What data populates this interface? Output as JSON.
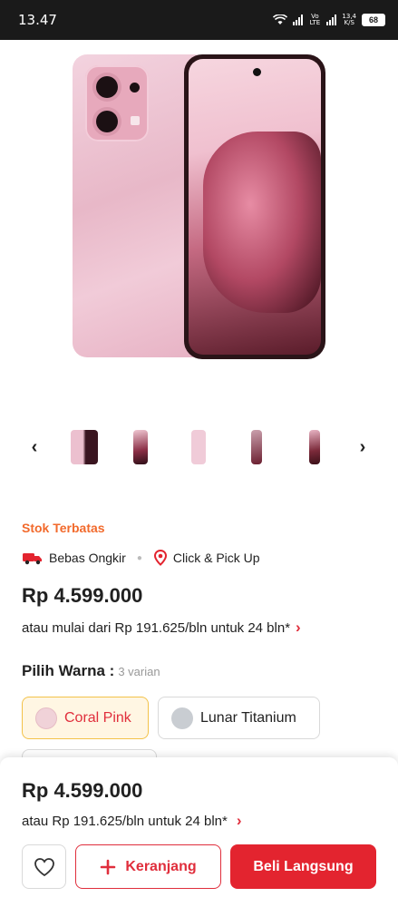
{
  "status_bar": {
    "time": "13.47",
    "network_label": "Vo LTE",
    "speed_value": "13,4",
    "speed_unit": "K/S",
    "battery": "68"
  },
  "product": {
    "stock_label": "Stok Terbatas",
    "shipping": {
      "free_shipping": "Bebas Ongkir",
      "pickup": "Click & Pick Up"
    },
    "price": "Rp 4.599.000",
    "installment": "atau mulai dari Rp 191.625/bln untuk 24 bln*",
    "color_selector": {
      "label": "Pilih Warna :",
      "variant_count": "3 varian",
      "options": [
        {
          "name": "Coral Pink",
          "swatch": "#f0d2d8",
          "selected": true
        },
        {
          "name": "Lunar Titanium",
          "swatch": "#c9cdd2",
          "selected": false
        }
      ]
    }
  },
  "thumbnails": [
    {
      "icon": "phone-thumbnail",
      "color": "#e8b4c4"
    },
    {
      "icon": "phone-thumbnail",
      "color": "#7b2a3a"
    },
    {
      "icon": "phone-thumbnail",
      "color": "#f1d0dc"
    },
    {
      "icon": "phone-thumbnail",
      "color": "#6b1f30"
    },
    {
      "icon": "phone-thumbnail",
      "color": "#8a3a4c"
    }
  ],
  "bottom_bar": {
    "price": "Rp 4.599.000",
    "installment": "atau Rp 191.625/bln untuk 24 bln*",
    "cart_label": "Keranjang",
    "buy_label": "Beli Langsung"
  },
  "colors": {
    "accent_red": "#e3242f",
    "stock_orange": "#f26a2c",
    "selected_chip_border": "#f3c249"
  }
}
